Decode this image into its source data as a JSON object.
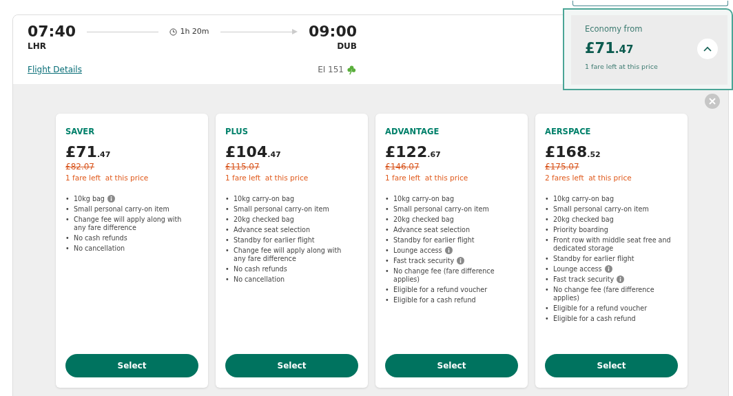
{
  "flight": {
    "departure_time": "07:40",
    "departure_airport": "LHR",
    "duration": "1h 20m",
    "arrival_time": "09:00",
    "arrival_airport": "DUB",
    "details_link": "Flight Details",
    "flight_number": "EI 151"
  },
  "economy_summary": {
    "label": "Economy from",
    "price": "£71.47",
    "availability": "1 fare left at this price",
    "expanded": true
  },
  "fares": [
    {
      "name": "SAVER",
      "price": "£71.47",
      "old_price": "£82.07",
      "availability": "1 fare left  at this price",
      "features": [
        {
          "marker": "•",
          "text": "10kg bag",
          "info": true
        },
        {
          "marker": "•",
          "text": "Small personal carry-on item",
          "info": false
        },
        {
          "marker": "•",
          "text": "Change fee will apply along with any fare difference",
          "info": false
        },
        {
          "marker": "•",
          "text": "No cash refunds",
          "info": false
        },
        {
          "marker": "•",
          "text": "No cancellation",
          "info": false
        }
      ],
      "button": "Select"
    },
    {
      "name": "PLUS",
      "price": "£104.47",
      "old_price": "£115.07",
      "availability": "1 fare left  at this price",
      "features": [
        {
          "marker": "•",
          "text": "10kg carry-on bag",
          "info": false
        },
        {
          "marker": "•",
          "text": "Small personal carry-on item",
          "info": false
        },
        {
          "marker": "•",
          "text": "20kg checked bag",
          "info": false
        },
        {
          "marker": "•",
          "text": "Advance seat selection",
          "info": false
        },
        {
          "marker": "•",
          "text": "Standby for earlier flight",
          "info": false
        },
        {
          "marker": "•",
          "text": "Change fee will apply along with any fare difference",
          "info": false
        },
        {
          "marker": "•",
          "text": "No cash refunds",
          "info": false
        },
        {
          "marker": "•",
          "text": "No cancellation",
          "info": false
        }
      ],
      "button": "Select"
    },
    {
      "name": "ADVANTAGE",
      "price": "£122.67",
      "old_price": "£146.07",
      "availability": "1 fare left  at this price",
      "features": [
        {
          "marker": "•",
          "text": "10kg carry-on bag",
          "info": false
        },
        {
          "marker": "•",
          "text": "Small personal carry-on item",
          "info": false
        },
        {
          "marker": "•",
          "text": "20kg checked bag",
          "info": false
        },
        {
          "marker": "•",
          "text": "Advance seat selection",
          "info": false
        },
        {
          "marker": "•",
          "text": "Standby for earlier flight",
          "info": false
        },
        {
          "marker": "•",
          "text": "Lounge access",
          "info": true
        },
        {
          "marker": "•",
          "text": "Fast track security",
          "info": true
        },
        {
          "marker": "•",
          "text": "No change fee (fare difference applies)",
          "info": false
        },
        {
          "marker": "•",
          "text": "Eligible for a refund voucher",
          "info": false
        },
        {
          "marker": "•",
          "text": "Eligible for a cash refund",
          "info": false
        }
      ],
      "button": "Select"
    },
    {
      "name": "AERSPACE",
      "price": "£168.52",
      "old_price": "£175.07",
      "availability": "2 fares left  at this price",
      "features": [
        {
          "marker": "•",
          "text": "10kg carry-on bag",
          "info": false
        },
        {
          "marker": "•",
          "text": "Small personal carry-on item",
          "info": false
        },
        {
          "marker": "•",
          "text": "20kg checked bag",
          "info": false
        },
        {
          "marker": "•",
          "text": "Priority boarding",
          "info": false
        },
        {
          "marker": "•",
          "text": "Front row with middle seat free and dedicated storage",
          "info": false
        },
        {
          "marker": "•",
          "text": "Standby for earlier flight",
          "info": false
        },
        {
          "marker": "•",
          "text": "Lounge access",
          "info": true
        },
        {
          "marker": "•",
          "text": "Fast track security",
          "info": true
        },
        {
          "marker": "•",
          "text": "No change fee (fare difference applies)",
          "info": false
        },
        {
          "marker": "•",
          "text": "Eligible for a refund voucher",
          "info": false
        },
        {
          "marker": "•",
          "text": "Eligible for a cash refund",
          "info": false
        }
      ],
      "button": "Select"
    }
  ]
}
